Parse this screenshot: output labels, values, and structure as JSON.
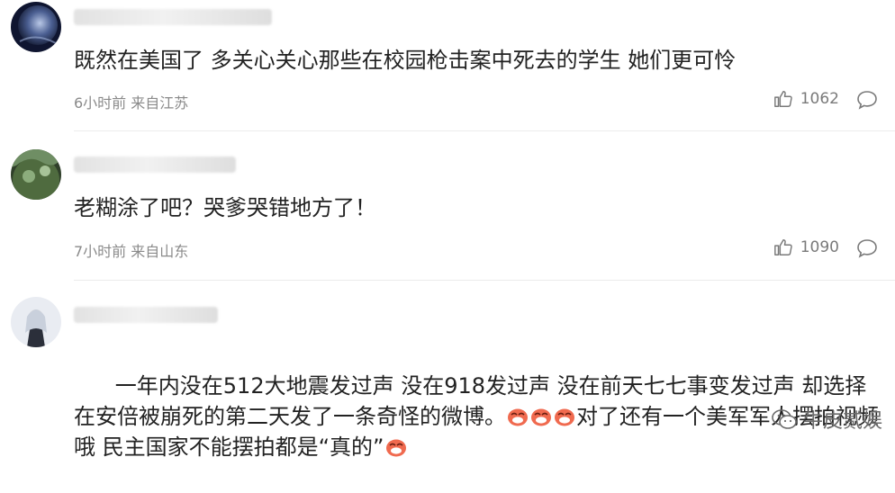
{
  "comments": [
    {
      "text": "既然在美国了 多关心关心那些在校园枪击案中死去的学生 她们更可怜",
      "time": "6小时前",
      "source": "来自江苏",
      "likes": "1062"
    },
    {
      "text": "老糊涂了吧？哭爹哭错地方了！",
      "time": "7小时前",
      "source": "来自山东",
      "likes": "1090"
    },
    {
      "text_part1": "一年内没在512大地震发过声 没在918发过声 没在前天七七事变发过声 却选择在安倍被崩死的第二天发了一条奇怪的微博。",
      "text_part2": "对了还有一个美军军人摆拍视频 哦 民主国家不能摆拍都是“真的”"
    }
  ],
  "watermark": {
    "label": "牛皮贰娱"
  },
  "colors": {
    "text": "#222222",
    "meta": "#8a8a8a",
    "divider": "#ececec",
    "emoji": "#f06a4f"
  }
}
